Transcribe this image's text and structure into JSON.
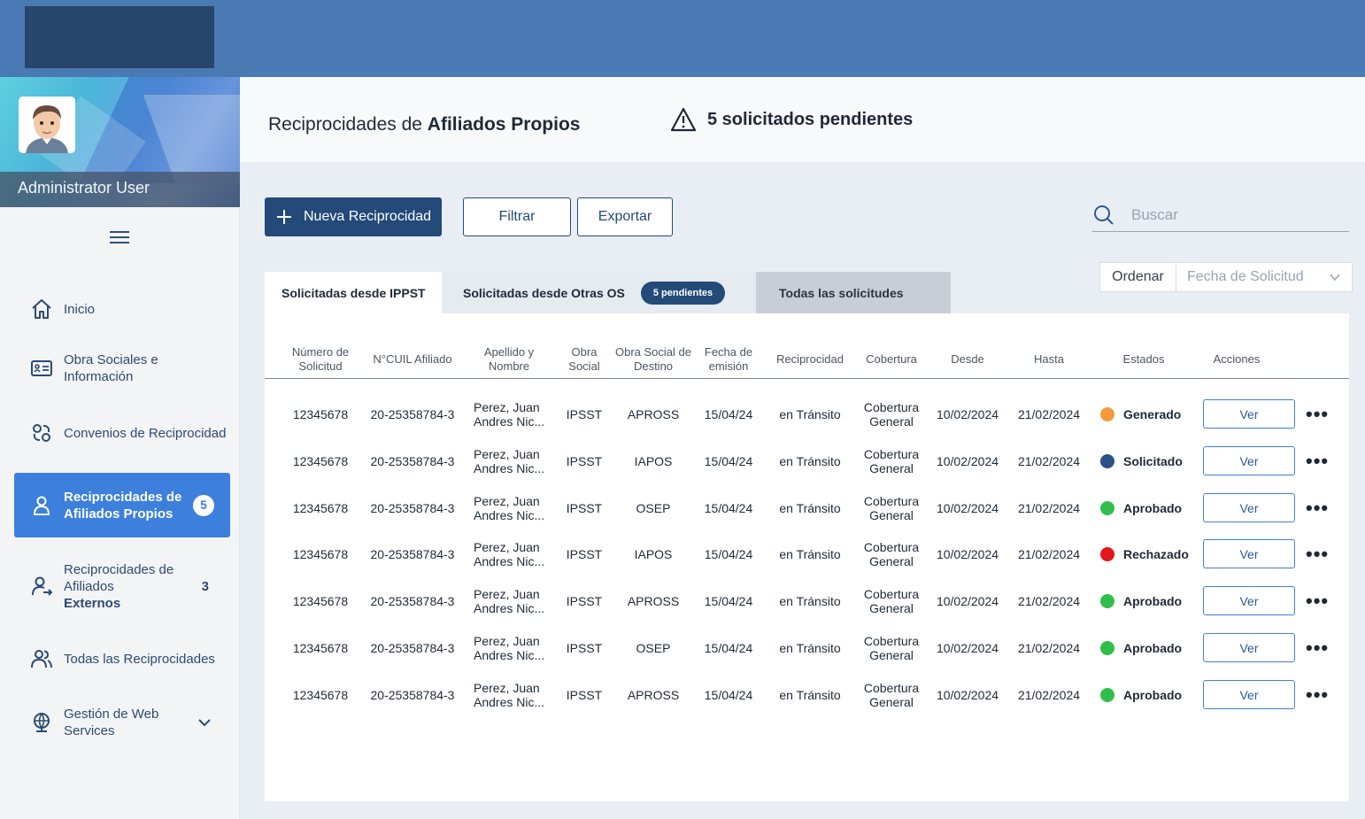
{
  "header": {
    "logo_alt": ""
  },
  "sidebar": {
    "user_name": "Administrator User",
    "items": [
      {
        "label": "Inicio",
        "icon": "home-icon"
      },
      {
        "label": "Obra Sociales e Información",
        "icon": "id-card-icon"
      },
      {
        "label": "Convenios de Reciprocidad",
        "icon": "handshake-icon"
      },
      {
        "label": "Reciprocidades de Afiliados Propios",
        "icon": "user-icon",
        "badge": "5",
        "active": true
      },
      {
        "label_a": "Reciprocidades de Afiliados",
        "label_b": "Externos",
        "icon": "user-arrow-icon",
        "count": "3"
      },
      {
        "label": "Todas las Reciprocidades",
        "icon": "users-icon"
      },
      {
        "label": "Gestión de Web Services",
        "icon": "globe-icon"
      }
    ]
  },
  "page": {
    "title_prefix": "Reciprocidades de ",
    "title_bold": "Afiliados Propios",
    "alert_text": "5 solicitados pendientes"
  },
  "toolbar": {
    "new_label": "Nueva Reciprocidad",
    "filter_label": "Filtrar",
    "export_label": "Exportar",
    "search_placeholder": "Buscar"
  },
  "tabs": [
    {
      "label": "Solicitadas desde IPPST"
    },
    {
      "label": "Solicitadas desde Otras OS",
      "pill": "5 pendientes"
    },
    {
      "label": "Todas las solicitudes"
    }
  ],
  "sort": {
    "label": "Ordenar",
    "value": "Fecha de Solicitud"
  },
  "table": {
    "headers": [
      "Número de Solicitud",
      "N°CUIL Afiliado",
      "Apellido y Nombre",
      "Obra Social",
      "Obra Social de Destino",
      "Fecha de emisión",
      "Reciprocidad",
      "Cobertura",
      "Desde",
      "Hasta",
      "Estados",
      "Acciones"
    ],
    "action_label": "Ver",
    "more_label": "•••",
    "rows": [
      {
        "num": "12345678",
        "cuil": "20-25358784-3",
        "nombre": "Perez, Juan Andres Nic...",
        "obra": "IPSST",
        "destino": "APROSS",
        "fecha": "15/04/24",
        "recip": "en Tránsito",
        "cobertura": "Cobertura General",
        "desde": "10/02/2024",
        "hasta": "21/02/2024",
        "estado": "Generado",
        "color": "#f59a3c"
      },
      {
        "num": "12345678",
        "cuil": "20-25358784-3",
        "nombre": "Perez, Juan Andres Nic...",
        "obra": "IPSST",
        "destino": "IAPOS",
        "fecha": "15/04/24",
        "recip": "en Tránsito",
        "cobertura": "Cobertura General",
        "desde": "10/02/2024",
        "hasta": "21/02/2024",
        "estado": "Solicitado",
        "color": "#2a4f8a"
      },
      {
        "num": "12345678",
        "cuil": "20-25358784-3",
        "nombre": "Perez, Juan Andres Nic...",
        "obra": "IPSST",
        "destino": "OSEP",
        "fecha": "15/04/24",
        "recip": "en Tránsito",
        "cobertura": "Cobertura General",
        "desde": "10/02/2024",
        "hasta": "21/02/2024",
        "estado": "Aprobado",
        "color": "#2fbf4a"
      },
      {
        "num": "12345678",
        "cuil": "20-25358784-3",
        "nombre": "Perez, Juan Andres Nic...",
        "obra": "IPSST",
        "destino": "IAPOS",
        "fecha": "15/04/24",
        "recip": "en Tránsito",
        "cobertura": "Cobertura General",
        "desde": "10/02/2024",
        "hasta": "21/02/2024",
        "estado": "Rechazado",
        "color": "#e3161c"
      },
      {
        "num": "12345678",
        "cuil": "20-25358784-3",
        "nombre": "Perez, Juan Andres Nic...",
        "obra": "IPSST",
        "destino": "APROSS",
        "fecha": "15/04/24",
        "recip": "en Tránsito",
        "cobertura": "Cobertura General",
        "desde": "10/02/2024",
        "hasta": "21/02/2024",
        "estado": "Aprobado",
        "color": "#2fbf4a"
      },
      {
        "num": "12345678",
        "cuil": "20-25358784-3",
        "nombre": "Perez, Juan Andres Nic...",
        "obra": "IPSST",
        "destino": "OSEP",
        "fecha": "15/04/24",
        "recip": "en Tránsito",
        "cobertura": "Cobertura General",
        "desde": "10/02/2024",
        "hasta": "21/02/2024",
        "estado": "Aprobado",
        "color": "#2fbf4a"
      },
      {
        "num": "12345678",
        "cuil": "20-25358784-3",
        "nombre": "Perez, Juan Andres Nic...",
        "obra": "IPSST",
        "destino": "APROSS",
        "fecha": "15/04/24",
        "recip": "en Tránsito",
        "cobertura": "Cobertura General",
        "desde": "10/02/2024",
        "hasta": "21/02/2024",
        "estado": "Aprobado",
        "color": "#2fbf4a"
      }
    ]
  },
  "colors": {
    "topbar": "#4a7ab3",
    "primary": "#234a78",
    "active_nav": "#3d7fdc"
  }
}
